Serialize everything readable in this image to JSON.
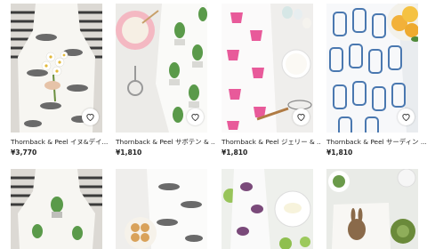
{
  "products": [
    {
      "title": "Thornback & Peel イヌ&デイ...",
      "price": "¥3,770",
      "image_icon": "apron-dog-daisy-photo",
      "favorite_icon": "heart-outline-icon"
    },
    {
      "title": "Thornback & Peel サボテン & ...",
      "price": "¥1,810",
      "image_icon": "cactus-tea-towel-photo",
      "favorite_icon": "heart-outline-icon"
    },
    {
      "title": "Thornback & Peel ジェリー & ...",
      "price": "¥1,810",
      "image_icon": "jelly-tea-towel-photo",
      "favorite_icon": "heart-outline-icon"
    },
    {
      "title": "Thornback & Peel サーディン ...",
      "price": "¥1,810",
      "image_icon": "sardine-tea-towel-photo",
      "favorite_icon": "heart-outline-icon"
    },
    {
      "title": "",
      "price": "",
      "image_icon": "apron-cactus-photo",
      "favorite_icon": ""
    },
    {
      "title": "",
      "price": "",
      "image_icon": "dog-tea-towel-photo",
      "favorite_icon": ""
    },
    {
      "title": "",
      "price": "",
      "image_icon": "bird-tea-towel-photo",
      "favorite_icon": ""
    },
    {
      "title": "",
      "price": "",
      "image_icon": "rabbit-tea-towel-photo",
      "favorite_icon": ""
    }
  ],
  "colors": {
    "background": "#ffffff",
    "text": "#222222",
    "jelly_pink": "#e85a9a",
    "sardine_blue": "#4a78b0",
    "cactus_green": "#5a9a4a"
  }
}
